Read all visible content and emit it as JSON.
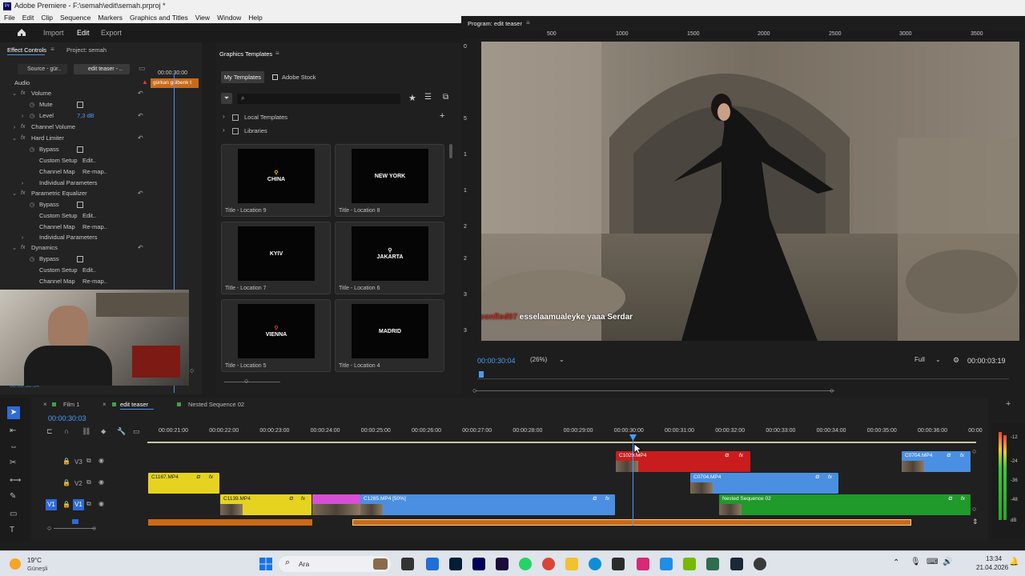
{
  "window": {
    "title": "Adobe Premiere - F:\\semah\\edit\\semah.prproj *"
  },
  "menu": [
    "File",
    "Edit",
    "Clip",
    "Sequence",
    "Markers",
    "Graphics and Titles",
    "View",
    "Window",
    "Help"
  ],
  "nav": {
    "import": "Import",
    "edit": "Edit",
    "export": "Export"
  },
  "effect_controls": {
    "tab": "Effect Controls",
    "project_tab": "Project: semah",
    "source_btn": "Source - gür..",
    "seq_btn": "edit teaser - ..",
    "tc": "00:00:30:00",
    "clip_label": "gürkan gülbenk t",
    "section": "Audio",
    "rows": [
      {
        "label": "Volume"
      },
      {
        "label": "Mute"
      },
      {
        "label": "Level",
        "value": "7,3 dB"
      },
      {
        "label": "Channel Volume"
      },
      {
        "label": "Hard Limiter"
      },
      {
        "label": "Bypass"
      },
      {
        "label": "Custom Setup",
        "value": "Edit.."
      },
      {
        "label": "Channel Map",
        "value": "Re-map.."
      },
      {
        "label": "Individual Parameters"
      },
      {
        "label": "Parametric Equalizer"
      },
      {
        "label": "Bypass"
      },
      {
        "label": "Custom Setup",
        "value": "Edit.."
      },
      {
        "label": "Channel Map",
        "value": "Re-map.."
      },
      {
        "label": "Individual Parameters"
      },
      {
        "label": "Dynamics"
      },
      {
        "label": "Bypass"
      },
      {
        "label": "Custom Setup",
        "value": "Edit.."
      },
      {
        "label": "Channel Map",
        "value": "Re-map.."
      }
    ],
    "bottom_tc": "00:00:30:04"
  },
  "graphics_templates": {
    "title": "Graphics Templates",
    "tab_my": "My Templates",
    "tab_stock": "Adobe Stock",
    "search_placeholder": "",
    "folders": [
      "Local Templates",
      "Libraries"
    ],
    "cards": [
      {
        "thumb": "CHINA",
        "caption": "Title - Location 9"
      },
      {
        "thumb": "NEW YORK",
        "caption": "Title - Location 8"
      },
      {
        "thumb": "KYIV",
        "caption": "Title - Location 7"
      },
      {
        "thumb": "JAKARTA",
        "caption": "Title - Location 6"
      },
      {
        "thumb": "VIENNA",
        "caption": "Title - Location 5"
      },
      {
        "thumb": "MADRID",
        "caption": "Title - Location 4"
      }
    ]
  },
  "program": {
    "title": "Program: edit teaser",
    "ruler": [
      "500",
      "1000",
      "1500",
      "2000",
      "2500",
      "3000",
      "3500"
    ],
    "vruler": [
      "0",
      "5",
      "1",
      "1",
      "2",
      "2",
      "3",
      "3"
    ],
    "chat_user": "woonfled07",
    "chat_msg": "esselaamualeyke yaaa Serdar",
    "timecode": "00:00:30:04",
    "zoom": "(26%)",
    "quality": "Full",
    "duration": "00:00:03:19"
  },
  "timeline": {
    "tabs": [
      "Film 1",
      "edit teaser",
      "Nested Sequence 02"
    ],
    "timecode": "00:00:30:03",
    "ticks": [
      "00:00:21:00",
      "00:00:22:00",
      "00:00:23:00",
      "00:00:24:00",
      "00:00:25:00",
      "00:00:26:00",
      "00:00:27:00",
      "00:00:28:00",
      "00:00:29:00",
      "00:00:30:00",
      "00:00:31:00",
      "00:00:32:00",
      "00:00:33:00",
      "00:00:34:00",
      "00:00:35:00",
      "00:00:36:00",
      "00:00"
    ],
    "tracks": [
      "V3",
      "V2",
      "V1"
    ],
    "clips": {
      "c1029": "C1029.MP4",
      "c0704a": "C0704.MP4",
      "c0704b": "C0704.MP4",
      "c1167": "C1167.MP4",
      "c1139": "C1139.MP4",
      "c1285": "C1285.MP4 [50%]",
      "nested": "Nested Sequence 02"
    },
    "fx": "fx",
    "meter": [
      "-12",
      "-24",
      "-36",
      "-48",
      "dB"
    ]
  },
  "taskbar": {
    "weather_temp": "19°C",
    "weather_loc": "Güneşli",
    "search": "Ara",
    "time": "13:34",
    "date": "21.04.2026"
  }
}
